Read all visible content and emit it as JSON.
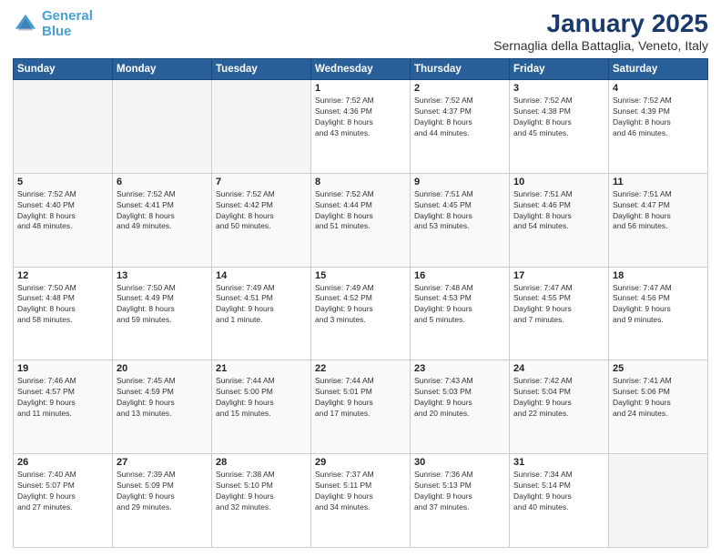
{
  "header": {
    "logo_line1": "General",
    "logo_line2": "Blue",
    "month": "January 2025",
    "location": "Sernaglia della Battaglia, Veneto, Italy"
  },
  "weekdays": [
    "Sunday",
    "Monday",
    "Tuesday",
    "Wednesday",
    "Thursday",
    "Friday",
    "Saturday"
  ],
  "weeks": [
    [
      {
        "day": "",
        "info": ""
      },
      {
        "day": "",
        "info": ""
      },
      {
        "day": "",
        "info": ""
      },
      {
        "day": "1",
        "info": "Sunrise: 7:52 AM\nSunset: 4:36 PM\nDaylight: 8 hours\nand 43 minutes."
      },
      {
        "day": "2",
        "info": "Sunrise: 7:52 AM\nSunset: 4:37 PM\nDaylight: 8 hours\nand 44 minutes."
      },
      {
        "day": "3",
        "info": "Sunrise: 7:52 AM\nSunset: 4:38 PM\nDaylight: 8 hours\nand 45 minutes."
      },
      {
        "day": "4",
        "info": "Sunrise: 7:52 AM\nSunset: 4:39 PM\nDaylight: 8 hours\nand 46 minutes."
      }
    ],
    [
      {
        "day": "5",
        "info": "Sunrise: 7:52 AM\nSunset: 4:40 PM\nDaylight: 8 hours\nand 48 minutes."
      },
      {
        "day": "6",
        "info": "Sunrise: 7:52 AM\nSunset: 4:41 PM\nDaylight: 8 hours\nand 49 minutes."
      },
      {
        "day": "7",
        "info": "Sunrise: 7:52 AM\nSunset: 4:42 PM\nDaylight: 8 hours\nand 50 minutes."
      },
      {
        "day": "8",
        "info": "Sunrise: 7:52 AM\nSunset: 4:44 PM\nDaylight: 8 hours\nand 51 minutes."
      },
      {
        "day": "9",
        "info": "Sunrise: 7:51 AM\nSunset: 4:45 PM\nDaylight: 8 hours\nand 53 minutes."
      },
      {
        "day": "10",
        "info": "Sunrise: 7:51 AM\nSunset: 4:46 PM\nDaylight: 8 hours\nand 54 minutes."
      },
      {
        "day": "11",
        "info": "Sunrise: 7:51 AM\nSunset: 4:47 PM\nDaylight: 8 hours\nand 56 minutes."
      }
    ],
    [
      {
        "day": "12",
        "info": "Sunrise: 7:50 AM\nSunset: 4:48 PM\nDaylight: 8 hours\nand 58 minutes."
      },
      {
        "day": "13",
        "info": "Sunrise: 7:50 AM\nSunset: 4:49 PM\nDaylight: 8 hours\nand 59 minutes."
      },
      {
        "day": "14",
        "info": "Sunrise: 7:49 AM\nSunset: 4:51 PM\nDaylight: 9 hours\nand 1 minute."
      },
      {
        "day": "15",
        "info": "Sunrise: 7:49 AM\nSunset: 4:52 PM\nDaylight: 9 hours\nand 3 minutes."
      },
      {
        "day": "16",
        "info": "Sunrise: 7:48 AM\nSunset: 4:53 PM\nDaylight: 9 hours\nand 5 minutes."
      },
      {
        "day": "17",
        "info": "Sunrise: 7:47 AM\nSunset: 4:55 PM\nDaylight: 9 hours\nand 7 minutes."
      },
      {
        "day": "18",
        "info": "Sunrise: 7:47 AM\nSunset: 4:56 PM\nDaylight: 9 hours\nand 9 minutes."
      }
    ],
    [
      {
        "day": "19",
        "info": "Sunrise: 7:46 AM\nSunset: 4:57 PM\nDaylight: 9 hours\nand 11 minutes."
      },
      {
        "day": "20",
        "info": "Sunrise: 7:45 AM\nSunset: 4:59 PM\nDaylight: 9 hours\nand 13 minutes."
      },
      {
        "day": "21",
        "info": "Sunrise: 7:44 AM\nSunset: 5:00 PM\nDaylight: 9 hours\nand 15 minutes."
      },
      {
        "day": "22",
        "info": "Sunrise: 7:44 AM\nSunset: 5:01 PM\nDaylight: 9 hours\nand 17 minutes."
      },
      {
        "day": "23",
        "info": "Sunrise: 7:43 AM\nSunset: 5:03 PM\nDaylight: 9 hours\nand 20 minutes."
      },
      {
        "day": "24",
        "info": "Sunrise: 7:42 AM\nSunset: 5:04 PM\nDaylight: 9 hours\nand 22 minutes."
      },
      {
        "day": "25",
        "info": "Sunrise: 7:41 AM\nSunset: 5:06 PM\nDaylight: 9 hours\nand 24 minutes."
      }
    ],
    [
      {
        "day": "26",
        "info": "Sunrise: 7:40 AM\nSunset: 5:07 PM\nDaylight: 9 hours\nand 27 minutes."
      },
      {
        "day": "27",
        "info": "Sunrise: 7:39 AM\nSunset: 5:09 PM\nDaylight: 9 hours\nand 29 minutes."
      },
      {
        "day": "28",
        "info": "Sunrise: 7:38 AM\nSunset: 5:10 PM\nDaylight: 9 hours\nand 32 minutes."
      },
      {
        "day": "29",
        "info": "Sunrise: 7:37 AM\nSunset: 5:11 PM\nDaylight: 9 hours\nand 34 minutes."
      },
      {
        "day": "30",
        "info": "Sunrise: 7:36 AM\nSunset: 5:13 PM\nDaylight: 9 hours\nand 37 minutes."
      },
      {
        "day": "31",
        "info": "Sunrise: 7:34 AM\nSunset: 5:14 PM\nDaylight: 9 hours\nand 40 minutes."
      },
      {
        "day": "",
        "info": ""
      }
    ]
  ]
}
